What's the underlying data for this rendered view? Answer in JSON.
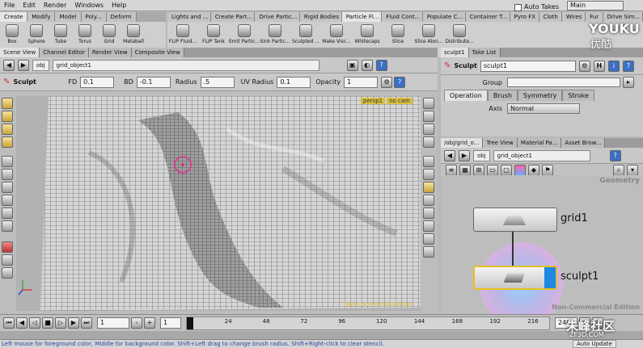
{
  "menu": {
    "file": "File",
    "edit": "Edit",
    "render": "Render",
    "windows": "Windows",
    "help": "Help",
    "auto_takes": "Auto Takes",
    "desktop": "Main"
  },
  "left_shelf_tabs": [
    "Create",
    "Modify",
    "Model",
    "Poly...",
    "Deform"
  ],
  "left_shelf_tools": [
    "Box",
    "Sphere",
    "Tube",
    "Torus",
    "Grid",
    "Metaball"
  ],
  "right_shelf_tabs": [
    "Lights and ...",
    "Create Part...",
    "Drive Partic...",
    "Rigid Bodies",
    "Particle Fl...",
    "Fluid Cont...",
    "Populate C...",
    "Container T...",
    "Pyro FX",
    "Cloth",
    "Wires",
    "Fur",
    "Drive Sim..."
  ],
  "right_shelf_tools": [
    "FLIP Fluid...",
    "FLIP Tank",
    "Emit Partic...",
    "Sink Partic...",
    "Sculpted ...",
    "Make Visc...",
    "Whitecaps",
    "Slice",
    "Slice Alon...",
    "Distribute..."
  ],
  "viewer": {
    "tabs": [
      "Scene View",
      "Channel Editor",
      "Render View",
      "Composite View"
    ],
    "path_obj": "obj",
    "path_node": "grid_object1"
  },
  "sculpt_bar": {
    "title": "Sculpt",
    "fd_label": "FD",
    "fd": "0.1",
    "bd_label": "BD",
    "bd": "-0.1",
    "radius_label": "Radius",
    "radius": ".5",
    "uv_radius_label": "UV Radius",
    "uv_radius": "0.1",
    "opacity_label": "Opacity",
    "opacity": "1"
  },
  "viewport": {
    "persp": "persp1",
    "cam": "no cam",
    "watermark": "Non-Commercial Edition"
  },
  "params": {
    "tabs": [
      "sculpt1",
      "Take List"
    ],
    "node_type": "Sculpt",
    "node_name": "sculpt1",
    "group_label": "Group",
    "group": "",
    "subtabs": [
      "Operation",
      "Brush",
      "Symmetry",
      "Stroke"
    ],
    "axis_label": "Axis",
    "axis": "Normal"
  },
  "network": {
    "tabs": [
      "/obj/grid_o...",
      "Tree View",
      "Material Pa...",
      "Asset Brow..."
    ],
    "path_obj": "obj",
    "path_node": "grid_object1",
    "context": "Geometry",
    "node1": "grid1",
    "node2": "sculpt1",
    "watermark": "Non-Commercial Edition"
  },
  "timeline": {
    "frame": "1",
    "start": "1",
    "ticks": [
      "1",
      "24",
      "48",
      "72",
      "96",
      "120",
      "144",
      "168",
      "192",
      "216"
    ],
    "end": "240",
    "auto_update": "Auto Update"
  },
  "status": "Left mouse for foreground color, Middle for background color. Shift+Left drag to change brush radius. Shift+Right-click to clear stencil.",
  "overlay": {
    "youku": "YOUKU",
    "youku_cn": "优酷",
    "zf3d": "ZF3D.COM",
    "zf3d_cn": "朱峰社区"
  }
}
